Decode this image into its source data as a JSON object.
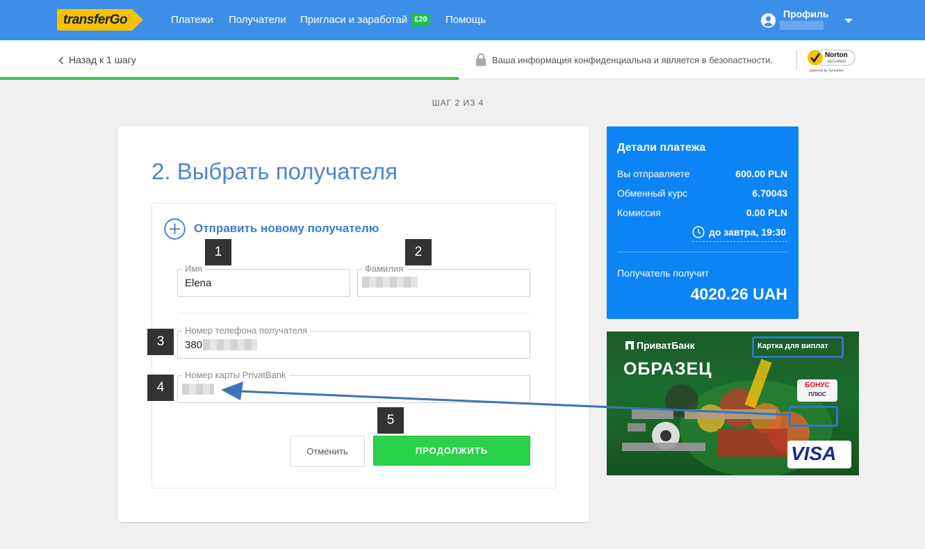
{
  "header": {
    "logo_text": "transferGo",
    "nav": [
      "Платежи",
      "Получатели",
      "Пригласи и заработай",
      "Помощь"
    ],
    "invite_badge": "£20",
    "profile_label": "Профиль"
  },
  "secure_bar": {
    "back_label": "Назад к 1 шагу",
    "secure_text": "Ваша информация конфиденциальна и является в безопастности.",
    "norton_brand": "Norton",
    "norton_sub": "SECURED",
    "norton_powered": "powered by Symantec"
  },
  "step_label": "ШАГ 2 ИЗ 4",
  "form": {
    "title": "2. Выбрать получателя",
    "new_recipient": "Отправить новому получателю",
    "first_name_label": "Имя",
    "first_name_value": "Elena",
    "last_name_label": "Фамилия",
    "phone_label": "Номер телефона получателя",
    "phone_value": "380",
    "card_label": "Номер карты PrivatBank",
    "cancel_label": "Отменить",
    "continue_label": "ПРОДОЛЖИТЬ"
  },
  "callouts": [
    "1",
    "2",
    "3",
    "4",
    "5"
  ],
  "payment": {
    "title": "Детали платежа",
    "send_label": "Вы отправляете",
    "send_value": "600.00 PLN",
    "rate_label": "Обменный курс",
    "rate_value": "6.70043",
    "fee_label": "Комиссия",
    "fee_value": "0.00 PLN",
    "delivery": "до завтра, 19:30",
    "receive_label": "Получатель получит",
    "receive_value": "4020.26 UAH"
  },
  "bank_card": {
    "bank_name": "ПриватБанк",
    "sample_label": "ОБРАЗЕЦ",
    "card_type": "Картка для виплат",
    "bonus_title": "БОНУС",
    "bonus_sub": "ПЛЮС",
    "network": "VISA"
  },
  "colors": {
    "topbar": "#3d8ee8",
    "accent_blue": "#0d84f5",
    "continue_green": "#2ad24a",
    "progress_green": "#37c24a"
  }
}
